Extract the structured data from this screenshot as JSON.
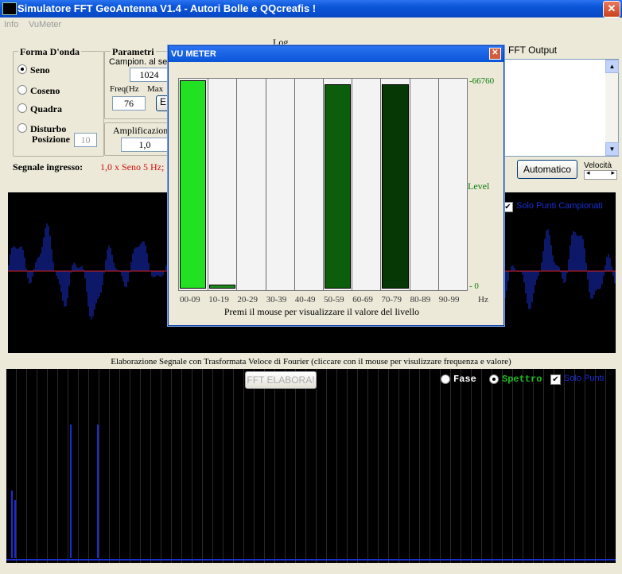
{
  "app": {
    "title": "Simulatore FFT GeoAntenna V1.4 - Autori Bolle e QQcreafis !",
    "close_glyph": "✕"
  },
  "menu": [
    "Info",
    "VuMeter"
  ],
  "forma": {
    "title": "Forma D'onda",
    "options": [
      {
        "label": "Seno",
        "selected": true
      },
      {
        "label": "Coseno",
        "selected": false
      },
      {
        "label": "Quadra",
        "selected": false
      },
      {
        "label": "Disturbo",
        "selected": false
      }
    ],
    "posizione_label": "Posizione",
    "posizione_value": "10"
  },
  "parametri": {
    "title": "Parametri",
    "campion_label": "Campion. al sec",
    "campion_value": "1024",
    "freq_label": "Freq(Hz",
    "max_label": "Max",
    "freq_value": "76",
    "button_partial": "E"
  },
  "amplificazione": {
    "label": "Amplificazion",
    "value": "1,0"
  },
  "log": {
    "title": "Log"
  },
  "fft_output": {
    "label": "FFT Output"
  },
  "segnale": {
    "label": "Segnale ingresso:",
    "value": "1,0 x Seno 5 Hz;"
  },
  "automatico_button": "Automatico",
  "velocita_label": "Velocità",
  "velocita_arrows": [
    "◂",
    "▸"
  ],
  "solo_punti_campionati": "Solo Punti Campionati",
  "elaborazione_caption": "Elaborazione Segnale con Trasformata Veloce di Fourier (cliccare con il mouse per visulizzare frequenza e valore)",
  "fft_elabora_button": "FFT ELABORA!",
  "fase_label": "Fase",
  "spettro_label": "Spettro",
  "solo_punti": "Solo Punti",
  "vu_meter": {
    "title": "VU METER",
    "max_label": "-66760",
    "level_label": "Level",
    "zero_label": "- 0",
    "hz_label": "Hz",
    "hint": "Premi il mouse per visualizzare il valore del livello",
    "bins": [
      "00-09",
      "10-19",
      "20-29",
      "30-39",
      "40-49",
      "50-59",
      "60-69",
      "70-79",
      "80-89",
      "90-99"
    ],
    "levels": [
      1.0,
      0.01,
      0.0,
      0.0,
      0.0,
      0.98,
      0.0,
      0.98,
      0.0,
      0.0
    ],
    "colors": [
      "#22e022",
      "#1f8a1f",
      "#1f8a1f",
      "#1f8a1f",
      "#1f8a1f",
      "#0c5e0c",
      "#1f8a1f",
      "#063806",
      "#1f8a1f",
      "#1f8a1f"
    ]
  },
  "colors": {
    "wave": "#1a2fd0",
    "axis": "#d02020",
    "accent_green": "#0a7a0a"
  }
}
